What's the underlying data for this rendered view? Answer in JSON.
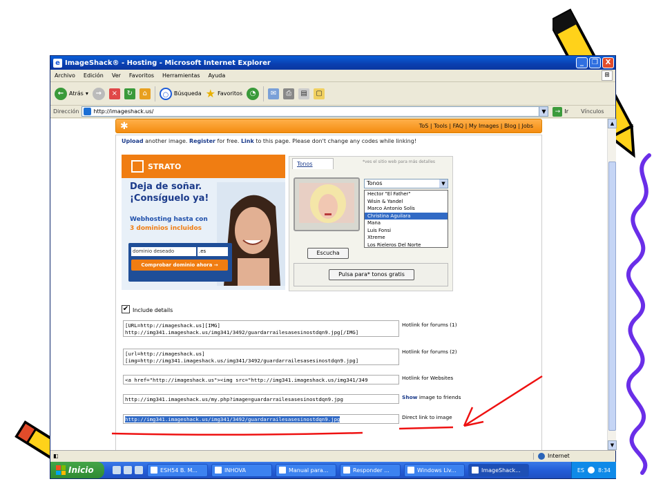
{
  "window": {
    "title": "ImageShack® - Hosting - Microsoft Internet Explorer",
    "controls": [
      "_",
      "❐",
      "X"
    ]
  },
  "menu": [
    "Archivo",
    "Edición",
    "Ver",
    "Favoritos",
    "Herramientas",
    "Ayuda"
  ],
  "toolbar": {
    "back_label": "Atrás",
    "search_label": "Búsqueda",
    "favorites_label": "Favoritos"
  },
  "address": {
    "label": "Dirección",
    "url": "http://imageshack.us/",
    "go_label": "Ir",
    "links_label": "Vínculos"
  },
  "page": {
    "nav_links": "ToS | Tools | FAQ | My Images | Blog | Jobs",
    "intro_upload": "Upload",
    "intro_part1": " another image. ",
    "intro_register": "Register",
    "intro_part2": " for free. ",
    "intro_link": "Link",
    "intro_part3": " to this page. Please don't change any codes while linking!",
    "include_details": "Include details",
    "rows": [
      {
        "code": "[URL=http://imageshack.us][IMG]\nhttp://img341.imageshack.us/img341/3492/guardarrailesasesinostdqn9.jpg[/IMG]",
        "label": "Hotlink for forums (1)"
      },
      {
        "code": "[url=http://imageshack.us]\n[img=http://img341.imageshack.us/img341/3492/guardarrailesasesinostdqn9.jpg]",
        "label": "Hotlink for forums (2)"
      },
      {
        "code": "<a href=\"http://imageshack.us\"><img src=\"http://img341.imageshack.us/img341/349",
        "label": "Hotlink for Websites"
      },
      {
        "code": "http://img341.imageshack.us/my.php?image=guardarrailesasesinostdqn9.jpg",
        "label_bold": "Show",
        "label": " image to friends"
      },
      {
        "code": "http://img341.imageshack.us/img341/3492/guardarrailesasesinostdqn9.jpg",
        "label": "Direct link to image"
      }
    ]
  },
  "ad_strato": {
    "brand": "STRATO",
    "headline1": "Deja de soñar.",
    "headline2": "¡Consíguelo ya!",
    "sub1": "Webhosting hasta con",
    "sub2": "3 dominios incluidos",
    "domain_placeholder": "dominio deseado",
    "tld": ".es",
    "button": "Comprobar dominio ahora →"
  },
  "ad_tonos": {
    "tab": "Tonos",
    "hint": "*ves el sitio web para más detalles",
    "select_value": "Tonos",
    "options": [
      "Hector \"El Father\"",
      "Wisin & Yandel",
      "Marco Antonio Solis",
      "Christina Aguilara",
      "Mana",
      "Luis Fonsi",
      "Xtreme",
      "Los Rieleros Del Norte"
    ],
    "selected_index": 3,
    "listen_button": "Escucha",
    "free_button": "Pulsa para* tonos gratis"
  },
  "status": {
    "zone": "Internet"
  },
  "taskbar": {
    "start": "Inicio",
    "tasks": [
      "ESH54 B. M...",
      "INHOVA",
      "Manual para...",
      "Responder ...",
      "Windows Liv...",
      "ImageShack..."
    ],
    "active_task": 5,
    "lang": "ES",
    "clock": "8:34"
  }
}
